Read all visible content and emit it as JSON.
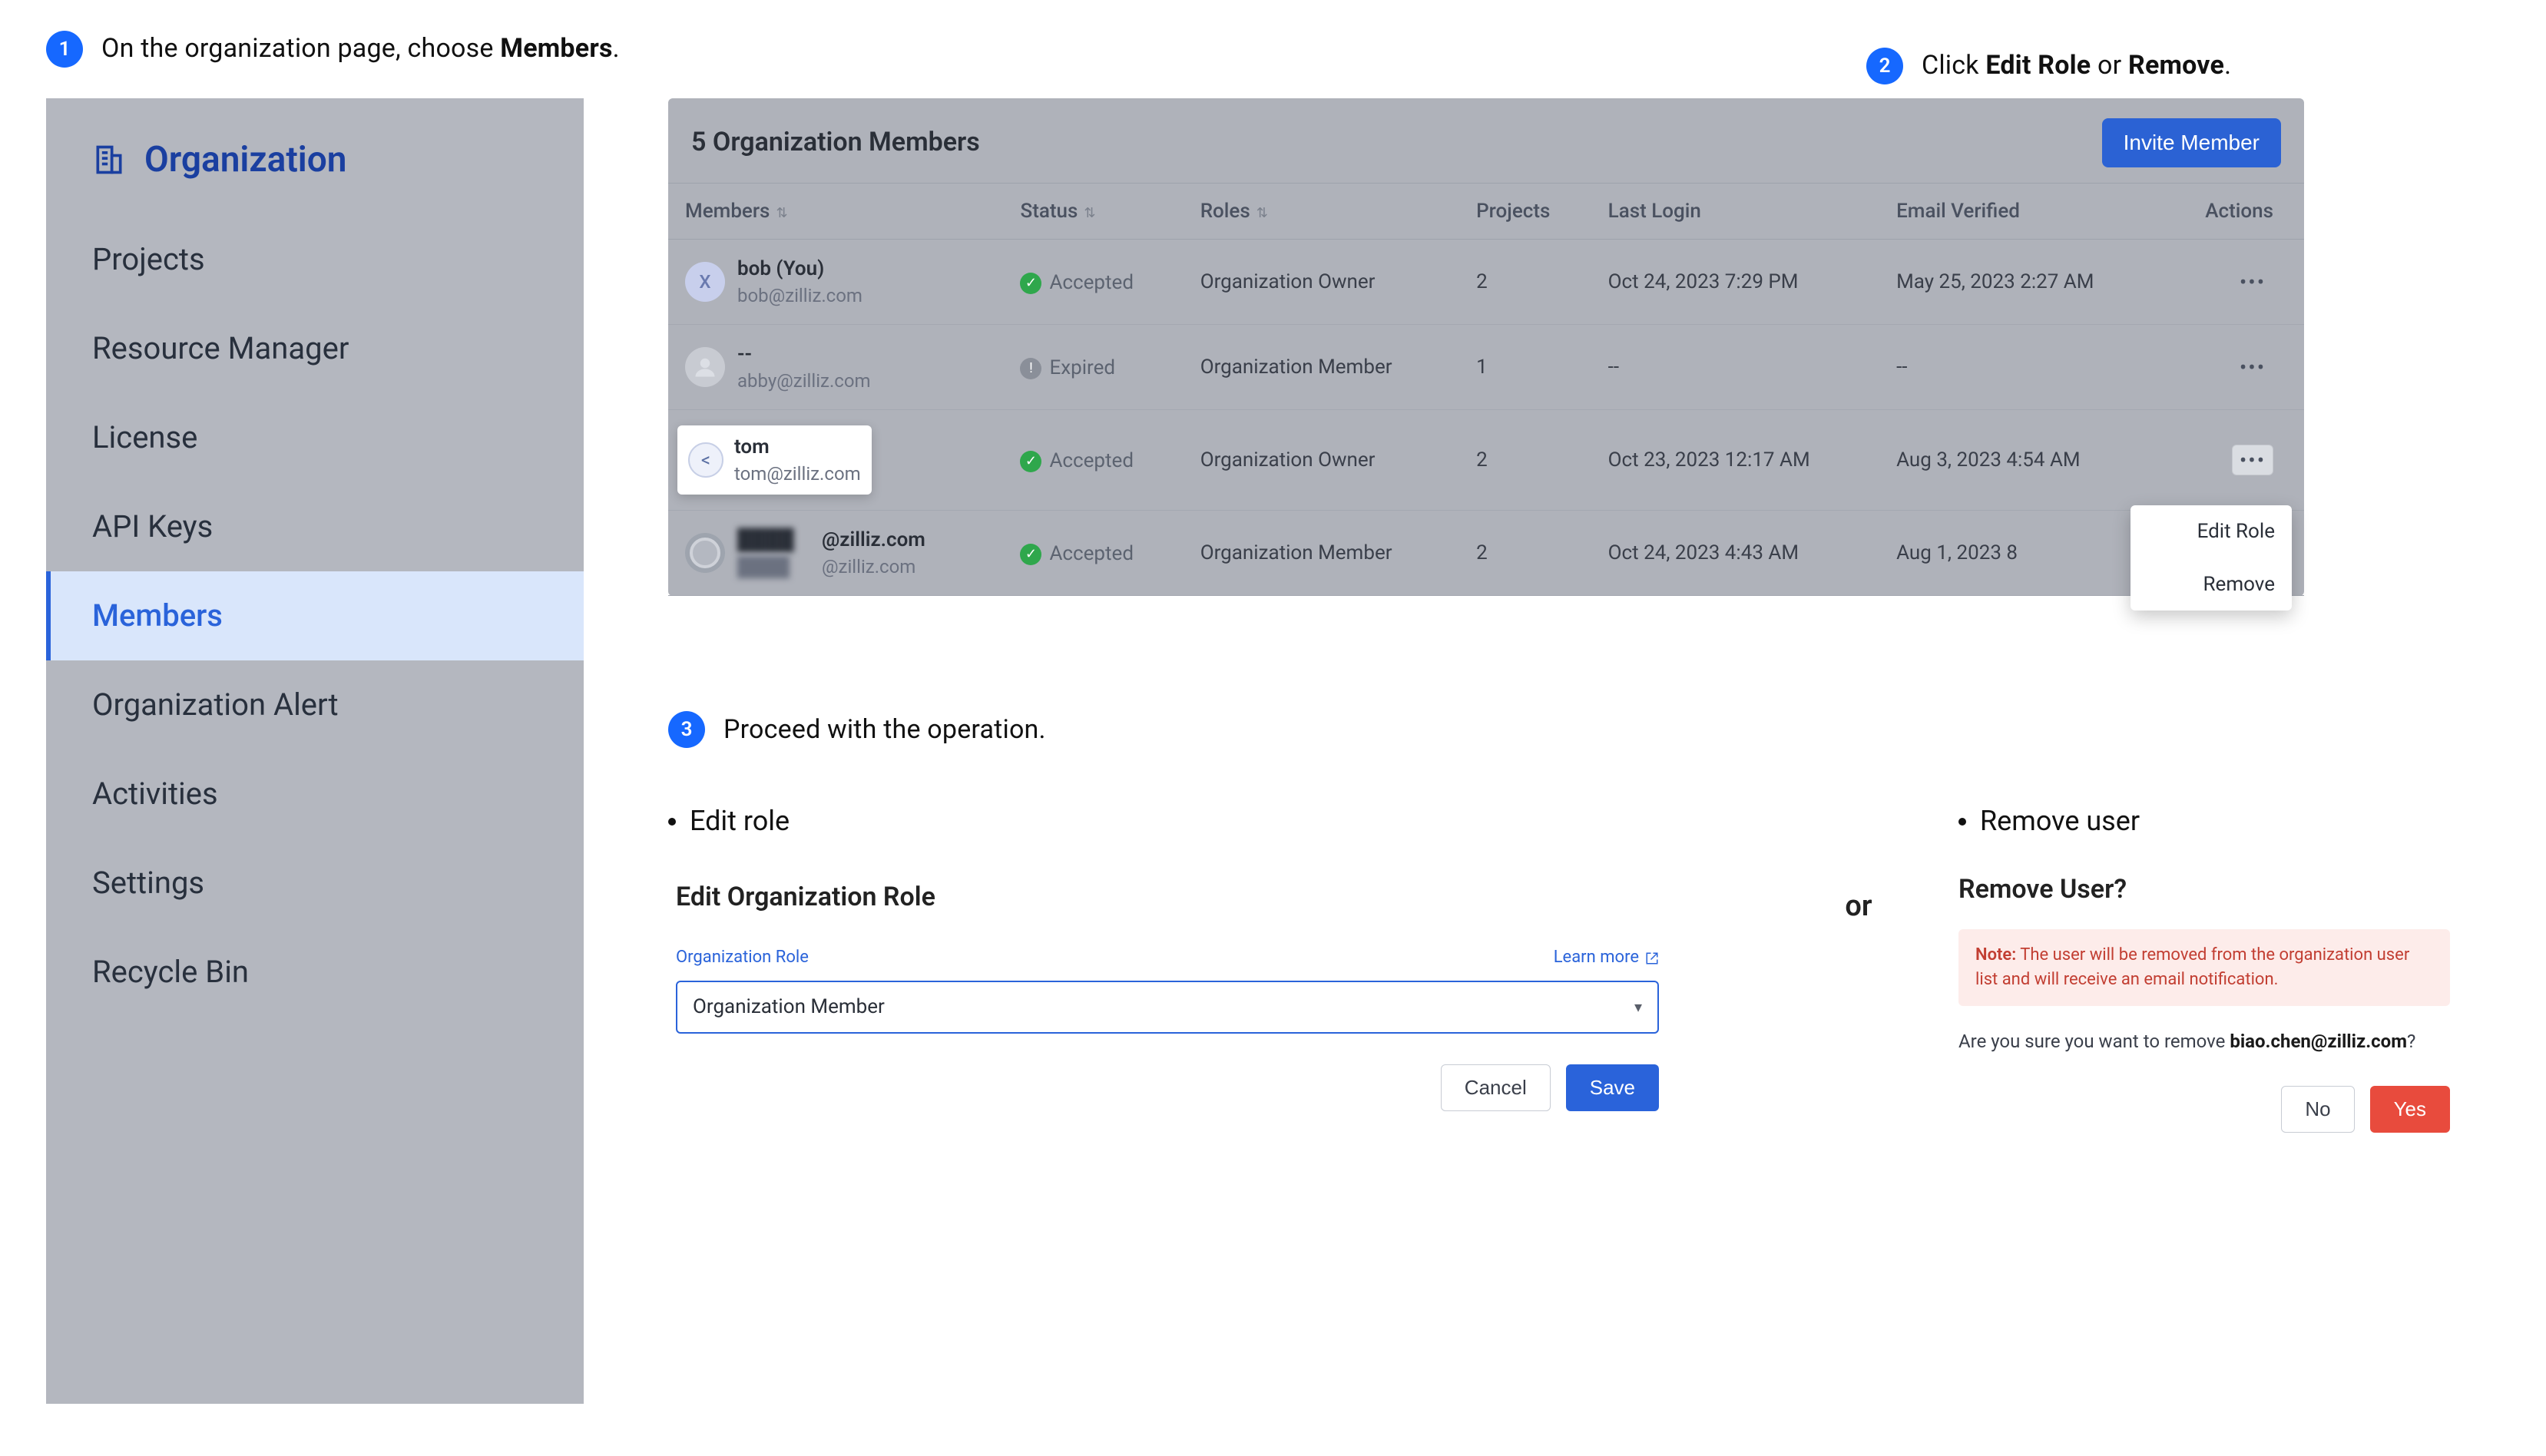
{
  "steps": {
    "s1_prefix": "On the organization page, choose ",
    "s1_bold": "Members",
    "s1_suffix": ".",
    "s2_prefix": "Click ",
    "s2_b1": "Edit Role",
    "s2_mid": " or ",
    "s2_b2": "Remove",
    "s2_suffix": ".",
    "s3": "Proceed with the operation."
  },
  "sidebar": {
    "title": "Organization",
    "items": [
      {
        "label": "Projects"
      },
      {
        "label": "Resource Manager"
      },
      {
        "label": "License"
      },
      {
        "label": "API Keys"
      },
      {
        "label": "Members"
      },
      {
        "label": "Organization Alert"
      },
      {
        "label": "Activities"
      },
      {
        "label": "Settings"
      },
      {
        "label": "Recycle Bin"
      }
    ]
  },
  "members": {
    "title": "5 Organization Members",
    "invite_label": "Invite Member",
    "columns": {
      "members": "Members",
      "status": "Status",
      "roles": "Roles",
      "projects": "Projects",
      "last_login": "Last Login",
      "email_verified": "Email Verified",
      "actions": "Actions"
    },
    "rows": [
      {
        "avatar": "X",
        "name": "bob (You)",
        "email": "bob@zilliz.com",
        "status": "Accepted",
        "status_kind": "ok",
        "role": "Organization Owner",
        "projects": "2",
        "last_login": "Oct 24, 2023 7:29 PM",
        "verified": "May 25, 2023 2:27 AM"
      },
      {
        "avatar": "",
        "name": "--",
        "email": "abby@zilliz.com",
        "status": "Expired",
        "status_kind": "warn",
        "role": "Organization Member",
        "projects": "1",
        "last_login": "--",
        "verified": "--"
      },
      {
        "avatar": "<",
        "name": "tom",
        "email": "tom@zilliz.com",
        "status": "Accepted",
        "status_kind": "ok",
        "role": "Organization Owner",
        "projects": "2",
        "last_login": "Oct 23, 2023 12:17 AM",
        "verified": "Aug 3, 2023 4:54 AM"
      },
      {
        "avatar": "",
        "name": "@zilliz.com",
        "email": "@zilliz.com",
        "status": "Accepted",
        "status_kind": "ok",
        "role": "Organization Member",
        "projects": "2",
        "last_login": "Oct 24, 2023 4:43 AM",
        "verified": "Aug 1, 2023 8"
      }
    ],
    "dropdown": {
      "edit": "Edit Role",
      "remove": "Remove"
    }
  },
  "bullets": {
    "edit": "Edit role",
    "remove": "Remove user",
    "or": "or"
  },
  "edit_dialog": {
    "title": "Edit Organization Role",
    "field_label": "Organization Role",
    "learn_more": "Learn more",
    "selected": "Organization Member",
    "cancel": "Cancel",
    "save": "Save"
  },
  "remove_dialog": {
    "title": "Remove User?",
    "note_label": "Note:",
    "note_text": " The user will be removed from the organization user list and will receive an email notification.",
    "confirm_prefix": "Are you sure you want to remove ",
    "confirm_bold": "biao.chen@zilliz.com",
    "confirm_suffix": "?",
    "no": "No",
    "yes": "Yes"
  }
}
